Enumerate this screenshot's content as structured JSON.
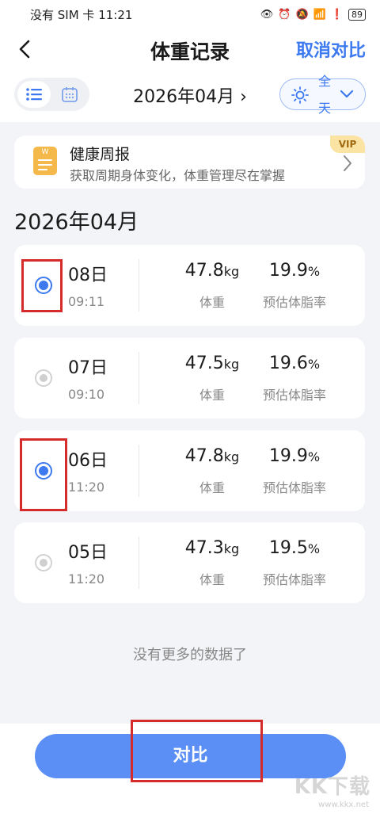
{
  "status": {
    "carrier": "没有 SIM 卡",
    "time": "11:21",
    "battery": "89"
  },
  "nav": {
    "title": "体重记录",
    "cancel_label": "取消对比"
  },
  "toolbar": {
    "month": "2026年04月",
    "range_label": "全天"
  },
  "weekly": {
    "title": "健康周报",
    "subtitle": "获取周期身体变化，体重管理尽在掌握",
    "badge": "VIP",
    "icon_letter": "W"
  },
  "section_title": "2026年04月",
  "labels": {
    "weight": "体重",
    "fat": "预估体脂率",
    "kg": "kg",
    "pct": "%"
  },
  "records": [
    {
      "day": "08日",
      "time": "09:11",
      "weight": "47.8",
      "fat": "19.9",
      "selected": true
    },
    {
      "day": "07日",
      "time": "09:10",
      "weight": "47.5",
      "fat": "19.6",
      "selected": false
    },
    {
      "day": "06日",
      "time": "11:20",
      "weight": "47.8",
      "fat": "19.9",
      "selected": true
    },
    {
      "day": "05日",
      "time": "11:20",
      "weight": "47.3",
      "fat": "19.5",
      "selected": false
    }
  ],
  "no_more_text": "没有更多的数据了",
  "compare_label": "对比",
  "watermark": {
    "text": "KK下载",
    "url": "www.kkx.net"
  },
  "colors": {
    "accent": "#3d7af0",
    "button": "#5b8ff5",
    "highlight": "#d52b2b"
  }
}
